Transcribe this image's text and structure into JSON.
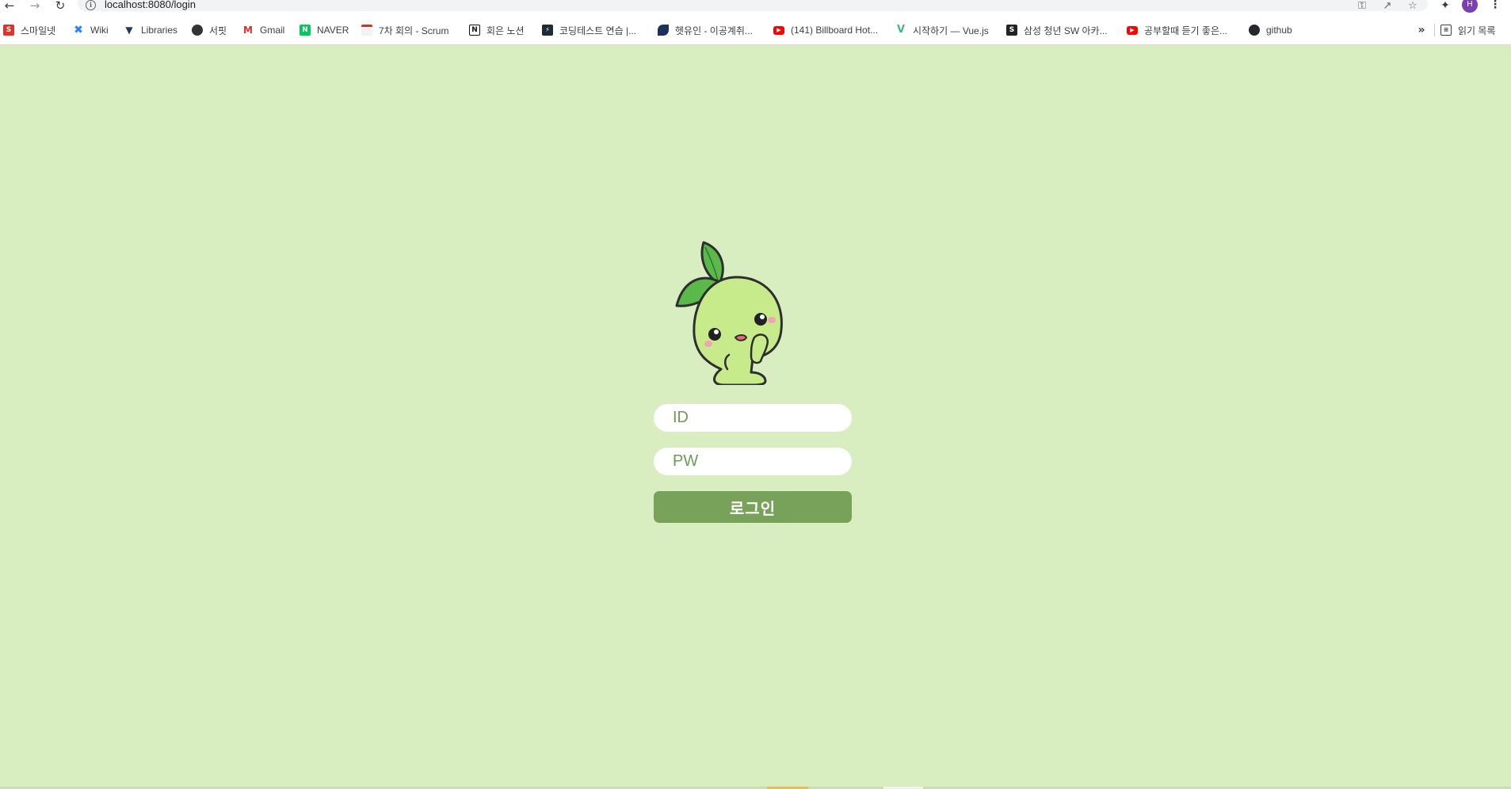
{
  "browser": {
    "url": "localhost:8080/login",
    "profile_initial": "H",
    "nav_icons": [
      "back-arrow-icon",
      "forward-arrow-icon",
      "reload-icon"
    ],
    "omnibox_icons": [
      "info-icon",
      "key-icon",
      "share-icon",
      "star-icon"
    ]
  },
  "bookmarks": {
    "items": [
      {
        "label": "스마일넷",
        "icon": "smilenet-icon",
        "color": "#e0312c"
      },
      {
        "label": "Wiki",
        "icon": "confluence-icon",
        "color": "#2684ff"
      },
      {
        "label": "Libraries",
        "icon": "vuetify-icon",
        "color": "#1e3a5a"
      },
      {
        "label": "서핏",
        "icon": "surfit-icon",
        "color": "#333333"
      },
      {
        "label": "Gmail",
        "icon": "gmail-icon",
        "color": "#d93025"
      },
      {
        "label": "NAVER",
        "icon": "naver-icon",
        "color": "#03c75a"
      },
      {
        "label": "7차 회의 - Scrum",
        "icon": "calendar-icon",
        "color": "#c0392b"
      },
      {
        "label": "회은 노션",
        "icon": "notion-icon",
        "color": "#111111"
      },
      {
        "label": "코딩테스트 연습 |...",
        "icon": "programmers-icon",
        "color": "#1e2a38"
      },
      {
        "label": "헷유인 - 이공계취...",
        "icon": "leaf-icon",
        "color": "#1f2f5a"
      },
      {
        "label": "(141) Billboard Hot...",
        "icon": "youtube-icon",
        "color": "#ff0000"
      },
      {
        "label": "시작하기 — Vue.js",
        "icon": "vue-icon",
        "color": "#42b883"
      },
      {
        "label": "삼성 청년 SW 아카...",
        "icon": "ssafy-icon",
        "color": "#222222"
      },
      {
        "label": "공부할때 듣기 좋은...",
        "icon": "youtube-icon",
        "color": "#ff0000"
      },
      {
        "label": "github",
        "icon": "github-icon",
        "color": "#24292e"
      }
    ],
    "overflow": "»",
    "reading_list": {
      "label": "읽기 목록",
      "icon": "reading-list-icon"
    }
  },
  "login": {
    "id_placeholder": "ID",
    "pw_placeholder": "PW",
    "submit_label": "로그인",
    "mascot": "sprout-mascot-illustration",
    "colors": {
      "background": "#d8eec1",
      "button": "#78a25a",
      "placeholder": "#6d9a56"
    }
  }
}
